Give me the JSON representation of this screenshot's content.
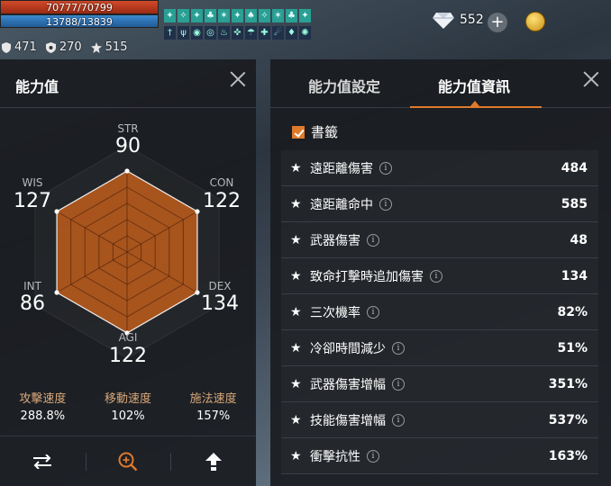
{
  "hud": {
    "hp": "70777/70799",
    "mp": "13788/13839",
    "stats": [
      {
        "icon": "shield-icon",
        "value": "471"
      },
      {
        "icon": "shield-gear-icon",
        "value": "270"
      },
      {
        "icon": "star-gear-icon",
        "value": "515"
      }
    ],
    "gems": "552"
  },
  "left": {
    "title": "能力值",
    "attrs": {
      "str": {
        "label": "STR",
        "value": "90"
      },
      "con": {
        "label": "CON",
        "value": "122"
      },
      "dex": {
        "label": "DEX",
        "value": "134"
      },
      "agi": {
        "label": "AGI",
        "value": "122"
      },
      "int": {
        "label": "INT",
        "value": "86"
      },
      "wis": {
        "label": "WIS",
        "value": "127"
      }
    },
    "speeds": [
      {
        "label": "攻擊速度",
        "value": "288.8%"
      },
      {
        "label": "移動速度",
        "value": "102%"
      },
      {
        "label": "施法速度",
        "value": "157%"
      }
    ]
  },
  "right": {
    "tabs": [
      "能力值設定",
      "能力值資訊"
    ],
    "bookmark": "書籤",
    "rows": [
      {
        "name": "遠距離傷害",
        "value": "484"
      },
      {
        "name": "遠距離命中",
        "value": "585"
      },
      {
        "name": "武器傷害",
        "value": "48"
      },
      {
        "name": "致命打擊時追加傷害",
        "value": "134"
      },
      {
        "name": "三次機率",
        "value": "82%"
      },
      {
        "name": "冷卻時間減少",
        "value": "51%"
      },
      {
        "name": "武器傷害增幅",
        "value": "351%"
      },
      {
        "name": "技能傷害增幅",
        "value": "537%"
      },
      {
        "name": "衝擊抗性",
        "value": "163%"
      }
    ]
  },
  "colors": {
    "accent": "#e07a2b",
    "radar_fill": "#b4581c",
    "hp_bar": "#c03a20",
    "mp_bar": "#2f76b8",
    "panel_bg": "#1a1c20"
  }
}
